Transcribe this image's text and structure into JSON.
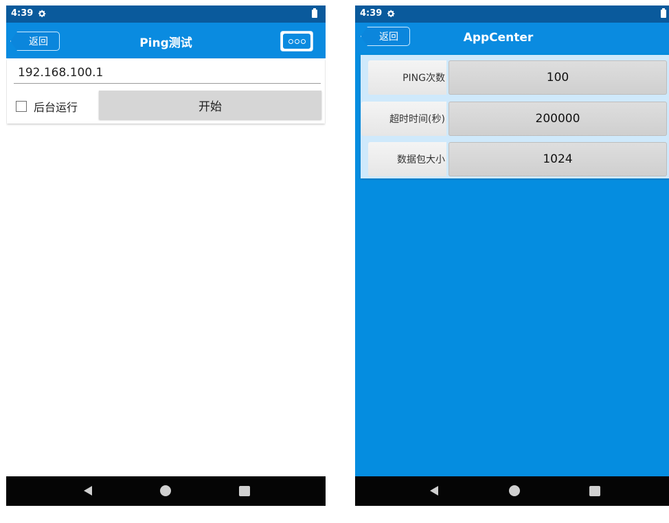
{
  "left": {
    "status": {
      "time": "4:39",
      "settings_icon": "gear-icon",
      "battery_icon": "battery-icon"
    },
    "header": {
      "back_label": "返回",
      "title": "Ping测试",
      "more_icon": "more-dots-icon"
    },
    "form": {
      "ip_value": "192.168.100.1",
      "background_label": "后台运行",
      "background_checked": false,
      "start_label": "开始"
    },
    "nav": {
      "back_icon": "nav-back-icon",
      "home_icon": "nav-home-icon",
      "recents_icon": "nav-recents-icon"
    }
  },
  "right": {
    "status": {
      "time": "4:39",
      "settings_icon": "gear-icon",
      "battery_icon": "battery-icon"
    },
    "header": {
      "back_label": "返回",
      "title": "AppCenter"
    },
    "fields": [
      {
        "label": "PING次数",
        "value": "100"
      },
      {
        "label": "超时时间(秒)",
        "value": "200000"
      },
      {
        "label": "数据包大小",
        "value": "1024"
      }
    ],
    "nav": {
      "back_icon": "nav-back-icon",
      "home_icon": "nav-home-icon",
      "recents_icon": "nav-recents-icon"
    }
  },
  "colors": {
    "status_bar": "#0a5a9c",
    "title_bar": "#0a8be0",
    "right_background": "#058de0",
    "nav_bar": "#050505",
    "button_gray": "#d6d6d6"
  }
}
